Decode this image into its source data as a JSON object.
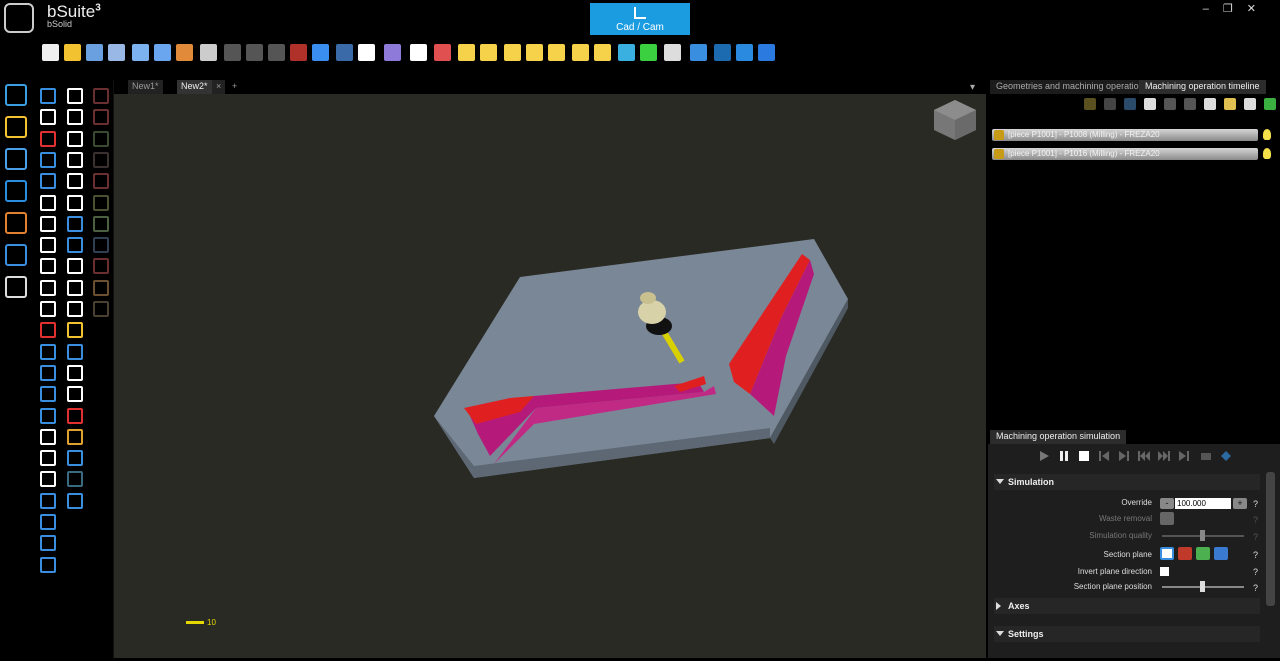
{
  "app": {
    "title": "bSuite",
    "version": "3",
    "subtitle": "bSolid",
    "mode_button": "Cad / Cam"
  },
  "window_controls": [
    "–",
    "❐",
    "✕"
  ],
  "toolbar_icons": [
    {
      "name": "new-file-icon",
      "color": "#f0f0f0"
    },
    {
      "name": "open-folder-icon",
      "color": "#f2c230"
    },
    {
      "name": "save-icon",
      "color": "#6aa0e0"
    },
    {
      "name": "save-as-icon",
      "color": "#9ab8e6"
    },
    {
      "name": "export-icon",
      "color": "#7db2f0"
    },
    {
      "name": "import-icon",
      "color": "#6aa6f0"
    },
    {
      "name": "export-2-icon",
      "color": "#e08a3a"
    },
    {
      "name": "print-icon",
      "color": "#cccccc"
    },
    {
      "name": "cut-icon",
      "color": "#555555"
    },
    {
      "name": "copy-icon",
      "color": "#555555"
    },
    {
      "name": "paste-icon",
      "color": "#555555"
    },
    {
      "name": "delete-icon",
      "color": "#b0302a"
    },
    {
      "name": "undo-icon",
      "color": "#3a8ef0"
    },
    {
      "name": "redo-icon",
      "color": "#3a6aa8"
    },
    {
      "name": "snap-icon",
      "color": "#ffffff"
    },
    {
      "name": "rotate-icon",
      "color": "#8e7ad8"
    },
    {
      "name": "pan-icon",
      "color": "#ffffff"
    },
    {
      "name": "zoom-icon",
      "color": "#e05050"
    },
    {
      "name": "view-front-icon",
      "color": "#f5d24a"
    },
    {
      "name": "view-top-icon",
      "color": "#f5d24a"
    },
    {
      "name": "view-left-icon",
      "color": "#f5d24a"
    },
    {
      "name": "view-right-icon",
      "color": "#f5d24a"
    },
    {
      "name": "view-back-icon",
      "color": "#f5d24a"
    },
    {
      "name": "view-iso-icon",
      "color": "#f5d24a"
    },
    {
      "name": "view-diamond-icon",
      "color": "#f5d24a"
    },
    {
      "name": "box-view-icon",
      "color": "#3ab0e0"
    },
    {
      "name": "arrow-green-icon",
      "color": "#3ad040"
    },
    {
      "name": "refresh-icon",
      "color": "#dddddd"
    },
    {
      "name": "crosshair-icon",
      "color": "#3a8ee0"
    },
    {
      "name": "sphere-icon",
      "color": "#1c6ab0"
    },
    {
      "name": "sphere-2-icon",
      "color": "#2a8ae0"
    },
    {
      "name": "help-icon",
      "color": "#2a7ae0"
    }
  ],
  "left_bar_icons": [
    {
      "name": "cad-draw-icon",
      "color": "#3a9ee0"
    },
    {
      "name": "geometry-icon",
      "color": "#f2c230"
    },
    {
      "name": "tool-line-icon",
      "color": "#4aa0e8"
    },
    {
      "name": "measure-icon",
      "color": "#2a8ee0"
    },
    {
      "name": "machining-icon",
      "color": "#e08030"
    },
    {
      "name": "shield-icon",
      "color": "#3a8ee0"
    },
    {
      "name": "tools-icon",
      "color": "#dddddd"
    }
  ],
  "tabs": {
    "items": [
      "New1*",
      "New2*"
    ],
    "add": "+"
  },
  "viewport": {
    "scale_label": "10"
  },
  "right_tabs": [
    "Geometries and machining operations",
    "Machining operation timeline"
  ],
  "operations": [
    {
      "label": "[piece P1001] - P1008 (Milling) - FREZA20"
    },
    {
      "label": "[piece P1001] - P1016 (Milling) - FREZA20"
    }
  ],
  "simulation": {
    "tab": "Machining operation simulation",
    "section_simulation": "Simulation",
    "override_label": "Override",
    "override_value": "100.000",
    "waste_removal_label": "Waste removal",
    "quality_label": "Simulation quality",
    "section_plane_label": "Section plane",
    "invert_label": "Invert plane direction",
    "position_label": "Section plane position",
    "section_axes": "Axes",
    "section_settings": "Settings",
    "help": "?",
    "minus": "-",
    "plus": "+"
  }
}
